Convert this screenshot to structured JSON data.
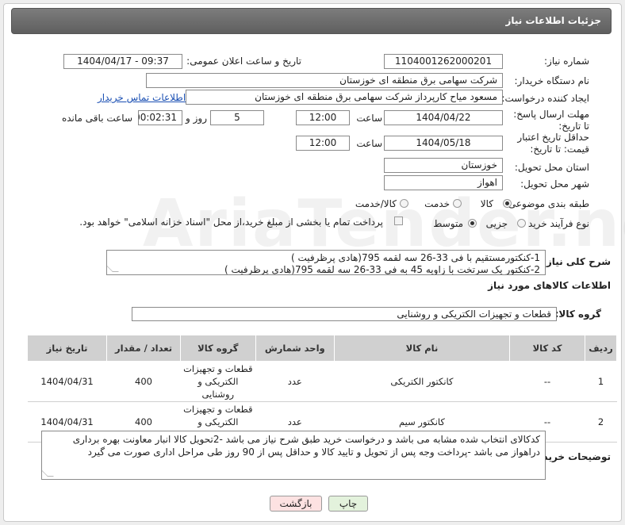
{
  "header": {
    "title": "جزئیات اطلاعات نیاز"
  },
  "fields": {
    "need_number_label": "شماره نیاز:",
    "need_number": "1104001262000201",
    "announce_label": "تاریخ و ساعت اعلان عمومی:",
    "announce_value": "1404/04/17 - 09:37",
    "buyer_label": "نام دستگاه خریدار:",
    "buyer_value": "شرکت سهامی برق منطقه ای خوزستان",
    "creator_label": "ایجاد کننده درخواست:",
    "creator_value": "مسعود میاح کارپرداز شرکت سهامی برق منطقه ای خوزستان",
    "contact_link": "اطلاعات تماس خریدار",
    "deadline_label": "مهلت ارسال پاسخ: تا تاریخ:",
    "deadline_date": "1404/04/22",
    "time_label": "ساعت",
    "deadline_time": "12:00",
    "days_value": "5",
    "days_label": "روز و",
    "remaining_value": "00:02:31",
    "remaining_label": "ساعت باقی مانده",
    "validity_label": "حداقل تاریخ اعتبار قیمت: تا تاریخ:",
    "validity_date": "1404/05/18",
    "validity_time": "12:00",
    "province_label": "استان محل تحویل:",
    "province_value": "خوزستان",
    "city_label": "شهر محل تحویل:",
    "city_value": "اهواز",
    "category_label": "طبقه بندی موضوعی:",
    "category_options": [
      "کالا",
      "خدمت",
      "کالا/خدمت"
    ],
    "category_selected": "کالا",
    "process_label": "نوع فرآیند خرید :",
    "process_options": [
      "جزیی",
      "متوسط"
    ],
    "process_selected": "متوسط",
    "payment_note": "پرداخت تمام یا بخشی از مبلغ خرید،از محل \"اسناد خزانه اسلامی\" خواهد بود."
  },
  "description": {
    "label": "شرح کلی نیاز:",
    "line1": "1-کنکتورمستقیم با فی 33-26 سه لقمه 795(هادی پرظرفیت )",
    "line2": "2-کنکتور یک سرتخت با زاویه 45 به فی 33-26 سه لقمه 795(هادی پرظرفیت )"
  },
  "goods_info": {
    "title": "اطلاعات کالاهای مورد نیاز",
    "group_label": "گروه کالا:",
    "group_value": "قطعات و تجهیزات الکتریکی و روشنایی"
  },
  "table": {
    "headers": [
      "ردیف",
      "کد کالا",
      "نام کالا",
      "واحد شمارش",
      "گروه کالا",
      "تعداد / مقدار",
      "تاریخ نیاز"
    ],
    "rows": [
      [
        "1",
        "--",
        "کانکتور الکتریکی",
        "عدد",
        "قطعات و تجهیزات الکتریکی و روشنایی",
        "400",
        "1404/04/31"
      ],
      [
        "2",
        "--",
        "کانکتور سیم",
        "عدد",
        "قطعات و تجهیزات الکتریکی و روشنایی",
        "400",
        "1404/04/31"
      ]
    ]
  },
  "buyer_notes": {
    "label": "توضیحات خریدار:",
    "text": "کدکالای انتخاب شده مشابه می باشد و درخواست خرید طبق شرح نیاز می باشد -2تحویل کالا انبار معاونت بهره برداری دراهواز می باشد -پرداخت وجه پس از تحویل و تایید کالا و حداقل پس از 90 روز طی مراحل اداری صورت می گیرد"
  },
  "buttons": {
    "print": "چاپ",
    "back": "بازگشت"
  },
  "colors": {
    "header_bg": "#6b6b6b",
    "link": "#1a4fb3",
    "back_button_bg": "#fde2e2",
    "print_button_bg": "#e3f2dc"
  }
}
